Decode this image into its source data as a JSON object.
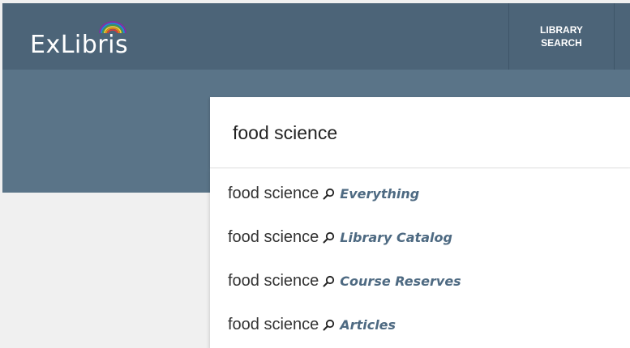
{
  "header": {
    "logo_text": "ExLibris",
    "nav_line1": "LIBRARY",
    "nav_line2": "SEARCH"
  },
  "search": {
    "query": "food science"
  },
  "suggestions": [
    {
      "term": "food science",
      "scope": "Everything",
      "icon": "search-icon"
    },
    {
      "term": "food science",
      "scope": "Library Catalog",
      "icon": "search-icon"
    },
    {
      "term": "food science",
      "scope": "Course Reserves",
      "icon": "search-icon"
    },
    {
      "term": "food science",
      "scope": "Articles",
      "icon": "search-icon"
    }
  ],
  "colors": {
    "header_bg": "#4c6478",
    "hero_bg": "#5a7488",
    "scope_text": "#4e6a82",
    "logo_arc": [
      "#e53935",
      "#fb8c00",
      "#fdd835",
      "#43a047",
      "#1e88e5",
      "#8e24aa"
    ]
  }
}
